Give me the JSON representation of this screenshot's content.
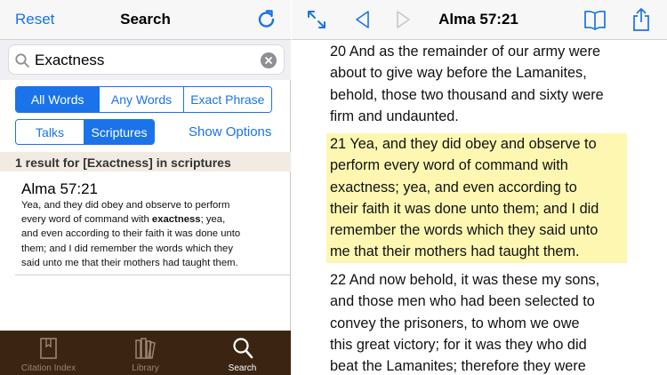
{
  "left": {
    "nav": {
      "reset": "Reset",
      "title": "Search",
      "refresh_icon": "refresh-icon"
    },
    "search": {
      "value": "Exactness",
      "placeholder": ""
    },
    "match_modes": [
      "All Words",
      "Any Words",
      "Exact Phrase"
    ],
    "match_mode_selected": 0,
    "sources": [
      "Talks",
      "Scriptures"
    ],
    "source_selected": 1,
    "show_options": "Show Options",
    "result_header": "1 result for [Exactness]  in scriptures",
    "result": {
      "reference": "Alma 57:21",
      "lines": [
        [
          "Yea, and they did obey and observe to perform",
          "",
          ""
        ],
        [
          "every word of command with ",
          "exactness",
          "; yea,"
        ],
        [
          "and even according to their faith it was done unto",
          "",
          ""
        ],
        [
          "them; and I did remember the words which they",
          "",
          ""
        ],
        [
          "said unto me that their mothers had taught them.",
          "",
          ""
        ]
      ]
    },
    "tabs": [
      {
        "label": "Citation Index",
        "icon": "citation-index-icon"
      },
      {
        "label": "Library",
        "icon": "library-icon"
      },
      {
        "label": "Search",
        "icon": "search-icon"
      }
    ],
    "active_tab": 2
  },
  "right": {
    "title": "Alma 57:21",
    "verses": [
      {
        "lines": [
          "20 And as the remainder of our army were",
          "about to give way before the Lamanites,",
          "behold, those two thousand and sixty were",
          "firm and undaunted."
        ],
        "highlight": false
      },
      {
        "lines": [
          "21 Yea, and they did obey and observe to",
          "perform every word of command with",
          "exactness; yea, and even according to",
          "their faith it was done unto them; and I did",
          "remember the words which they said unto",
          "me that their mothers had taught them."
        ],
        "highlight": true
      },
      {
        "lines": [
          "22 And now behold, it was these my sons,",
          "and those men who had been selected to",
          "convey the prisoners, to whom we owe",
          "this great victory; for it was they who did",
          "beat the Lamanites; therefore they were"
        ],
        "highlight": false
      }
    ]
  },
  "colors": {
    "accent": "#1a73e8",
    "highlight": "#fdf7b2",
    "tabbar": "#3b2512",
    "result_header": "#f2ebe4"
  }
}
